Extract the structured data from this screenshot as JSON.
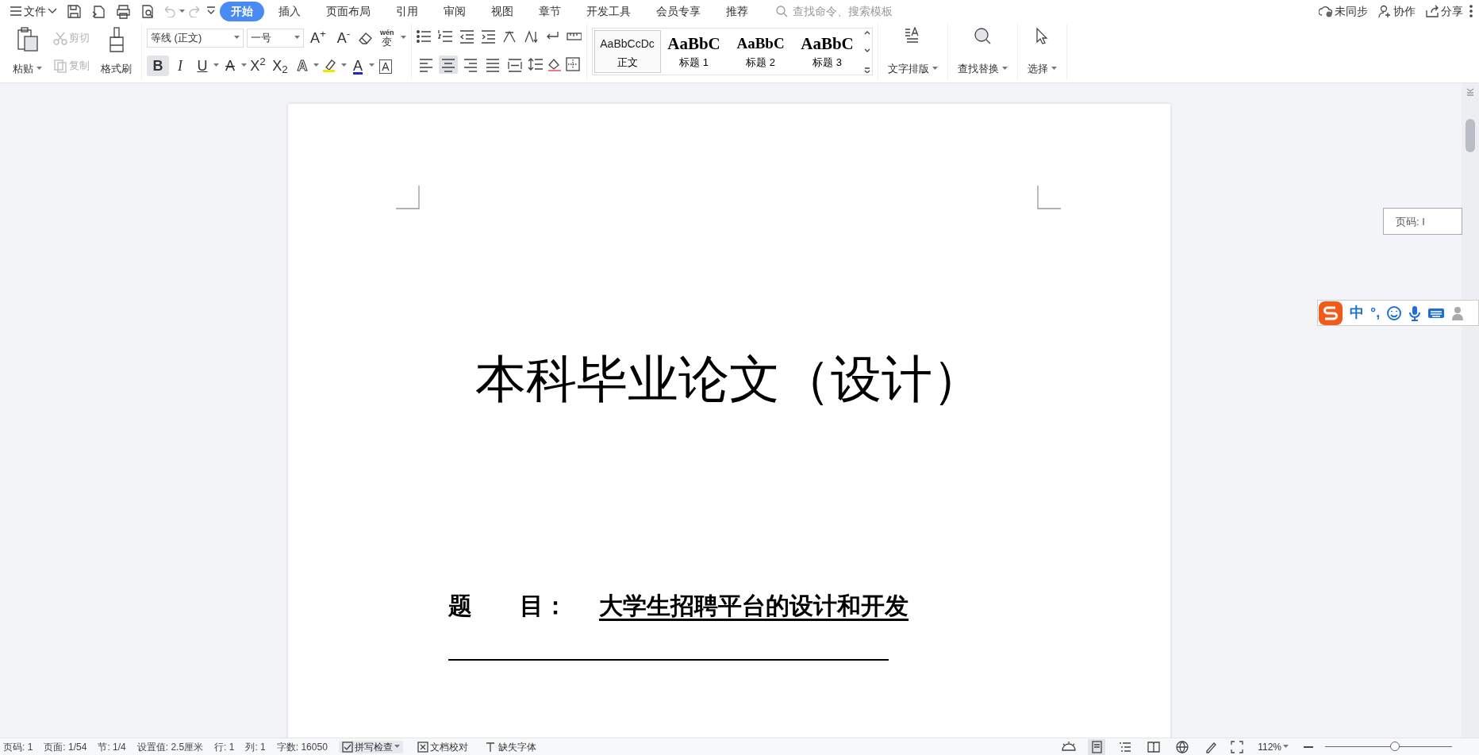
{
  "menu": {
    "file": "文件",
    "tabs": [
      {
        "label": "开始",
        "selected": true
      },
      {
        "label": "插入",
        "selected": false
      },
      {
        "label": "页面布局",
        "selected": false
      },
      {
        "label": "引用",
        "selected": false
      },
      {
        "label": "审阅",
        "selected": false
      },
      {
        "label": "视图",
        "selected": false
      },
      {
        "label": "章节",
        "selected": false
      },
      {
        "label": "开发工具",
        "selected": false
      },
      {
        "label": "会员专享",
        "selected": false
      },
      {
        "label": "推荐",
        "selected": false
      }
    ],
    "search": {
      "placeholder": "查找命令、搜索模板"
    },
    "actions": [
      {
        "kind": "sync",
        "label": "未同步"
      },
      {
        "kind": "collab",
        "label": "协作"
      },
      {
        "kind": "share",
        "label": "分享"
      }
    ]
  },
  "ribbon": {
    "paste": "粘贴",
    "cut": {
      "label": "剪切",
      "disabled": true
    },
    "copy": {
      "label": "复制",
      "disabled": true
    },
    "painter": "格式刷",
    "font_name": "等线 (正文)",
    "font_size": "一号",
    "font_tools": [
      {
        "kind": "text",
        "label": "A$^{+}$"
      },
      {
        "kind": "text",
        "label": "A$^{-}$"
      },
      {
        "kind": "eraser"
      },
      {
        "kind": "pinyin",
        "top": "wén",
        "label": "变"
      }
    ],
    "format_buttons": [
      {
        "label": "B",
        "kind": "bold",
        "selected": true
      },
      {
        "label": "I",
        "kind": "italic",
        "selected": false
      },
      {
        "label": "U",
        "kind": "underline",
        "selected": false
      },
      {
        "label": "A",
        "kind": "strike",
        "selected": false
      },
      {
        "label": "X$^{2}$",
        "kind": "plain",
        "selected": false
      },
      {
        "label": "X$_{2}$",
        "kind": "plain",
        "selected": false
      },
      {
        "label": "A",
        "kind": "outline",
        "selected": false
      },
      {
        "kind": "highlight",
        "selected": false
      },
      {
        "label": "A",
        "kind": "color",
        "selected": false
      },
      {
        "label": "A",
        "kind": "boxed",
        "selected": false
      }
    ],
    "align": [
      {
        "kind": "left",
        "selected": false
      },
      {
        "kind": "center",
        "selected": true
      },
      {
        "kind": "right",
        "selected": false
      },
      {
        "kind": "justify",
        "selected": false
      },
      {
        "kind": "distribute",
        "selected": false
      }
    ],
    "styles": [
      {
        "preview": "AaBbCcDc",
        "label": "正文",
        "kind": "normal",
        "selected": true
      },
      {
        "preview": "AaBbC",
        "label": "标题 1",
        "kind": "h1",
        "selected": false
      },
      {
        "preview": "AaBbC",
        "label": "标题 2",
        "kind": "h2",
        "selected": false
      },
      {
        "preview": "AaBbC",
        "label": "标题 3",
        "kind": "h3",
        "selected": false
      }
    ],
    "big_buttons": [
      {
        "kind": "layout",
        "label": "文字排版"
      },
      {
        "kind": "find",
        "label": "查找替换"
      },
      {
        "kind": "select",
        "label": "选择"
      }
    ]
  },
  "document": {
    "title": "本科毕业论文（设计）",
    "field_label": "题　　目：",
    "field_value": "大学生招聘平台的设计和开发"
  },
  "page_tooltip": "页码: I",
  "ime": {
    "mode": "中",
    "punct": "°,"
  },
  "status_bar": {
    "items": [
      "页码: 1",
      "页面: 1/54",
      "节: 1/4",
      "设置值: 2.5厘米",
      "行: 1",
      "列: 1",
      "字数: 16050"
    ],
    "spell": "拼写检查",
    "proof": "文档校对",
    "fonts": "缺失字体",
    "views": [
      {
        "kind": "page",
        "selected": true
      },
      {
        "kind": "outline",
        "selected": false
      },
      {
        "kind": "read",
        "selected": false
      },
      {
        "kind": "web",
        "selected": false
      },
      {
        "kind": "write",
        "selected": false
      }
    ],
    "zoom": "112%",
    "zoom_slider": {
      "level": 0.55
    }
  }
}
